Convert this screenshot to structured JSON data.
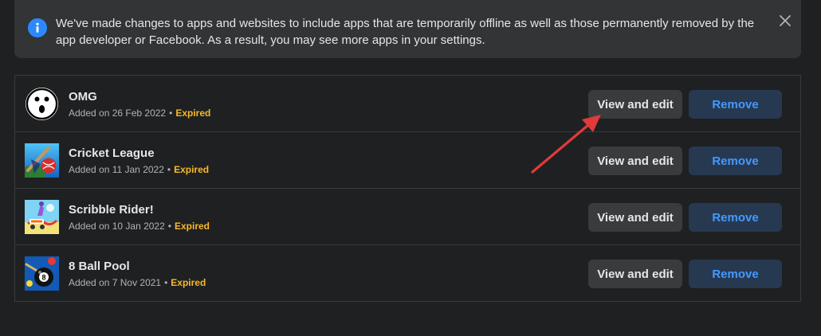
{
  "notice": {
    "text": "We've made changes to apps and websites to include apps that are temporarily offline as well as those permanently removed by the app developer or Facebook. As a result, you may see more apps in your settings.",
    "icon": "info-icon",
    "close_icon": "close-icon"
  },
  "apps": [
    {
      "name": "OMG",
      "added": "Added on 26 Feb 2022",
      "status": "Expired",
      "icon": "omg-face-icon",
      "edit_label": "View and edit",
      "remove_label": "Remove"
    },
    {
      "name": "Cricket League",
      "added": "Added on 11 Jan 2022",
      "status": "Expired",
      "icon": "cricket-league-icon",
      "edit_label": "View and edit",
      "remove_label": "Remove"
    },
    {
      "name": "Scribble Rider!",
      "added": "Added on 10 Jan 2022",
      "status": "Expired",
      "icon": "scribble-rider-icon",
      "edit_label": "View and edit",
      "remove_label": "Remove"
    },
    {
      "name": "8 Ball Pool",
      "added": "Added on 7 Nov 2021",
      "status": "Expired",
      "icon": "8-ball-pool-icon",
      "edit_label": "View and edit",
      "remove_label": "Remove"
    }
  ],
  "colors": {
    "background": "#1f2022",
    "panel": "#323436",
    "accent": "#2d88ff",
    "status_expired": "#f7b928",
    "annotation_arrow": "#e03a3a"
  },
  "annotation": {
    "icon": "red-arrow-annotation"
  }
}
